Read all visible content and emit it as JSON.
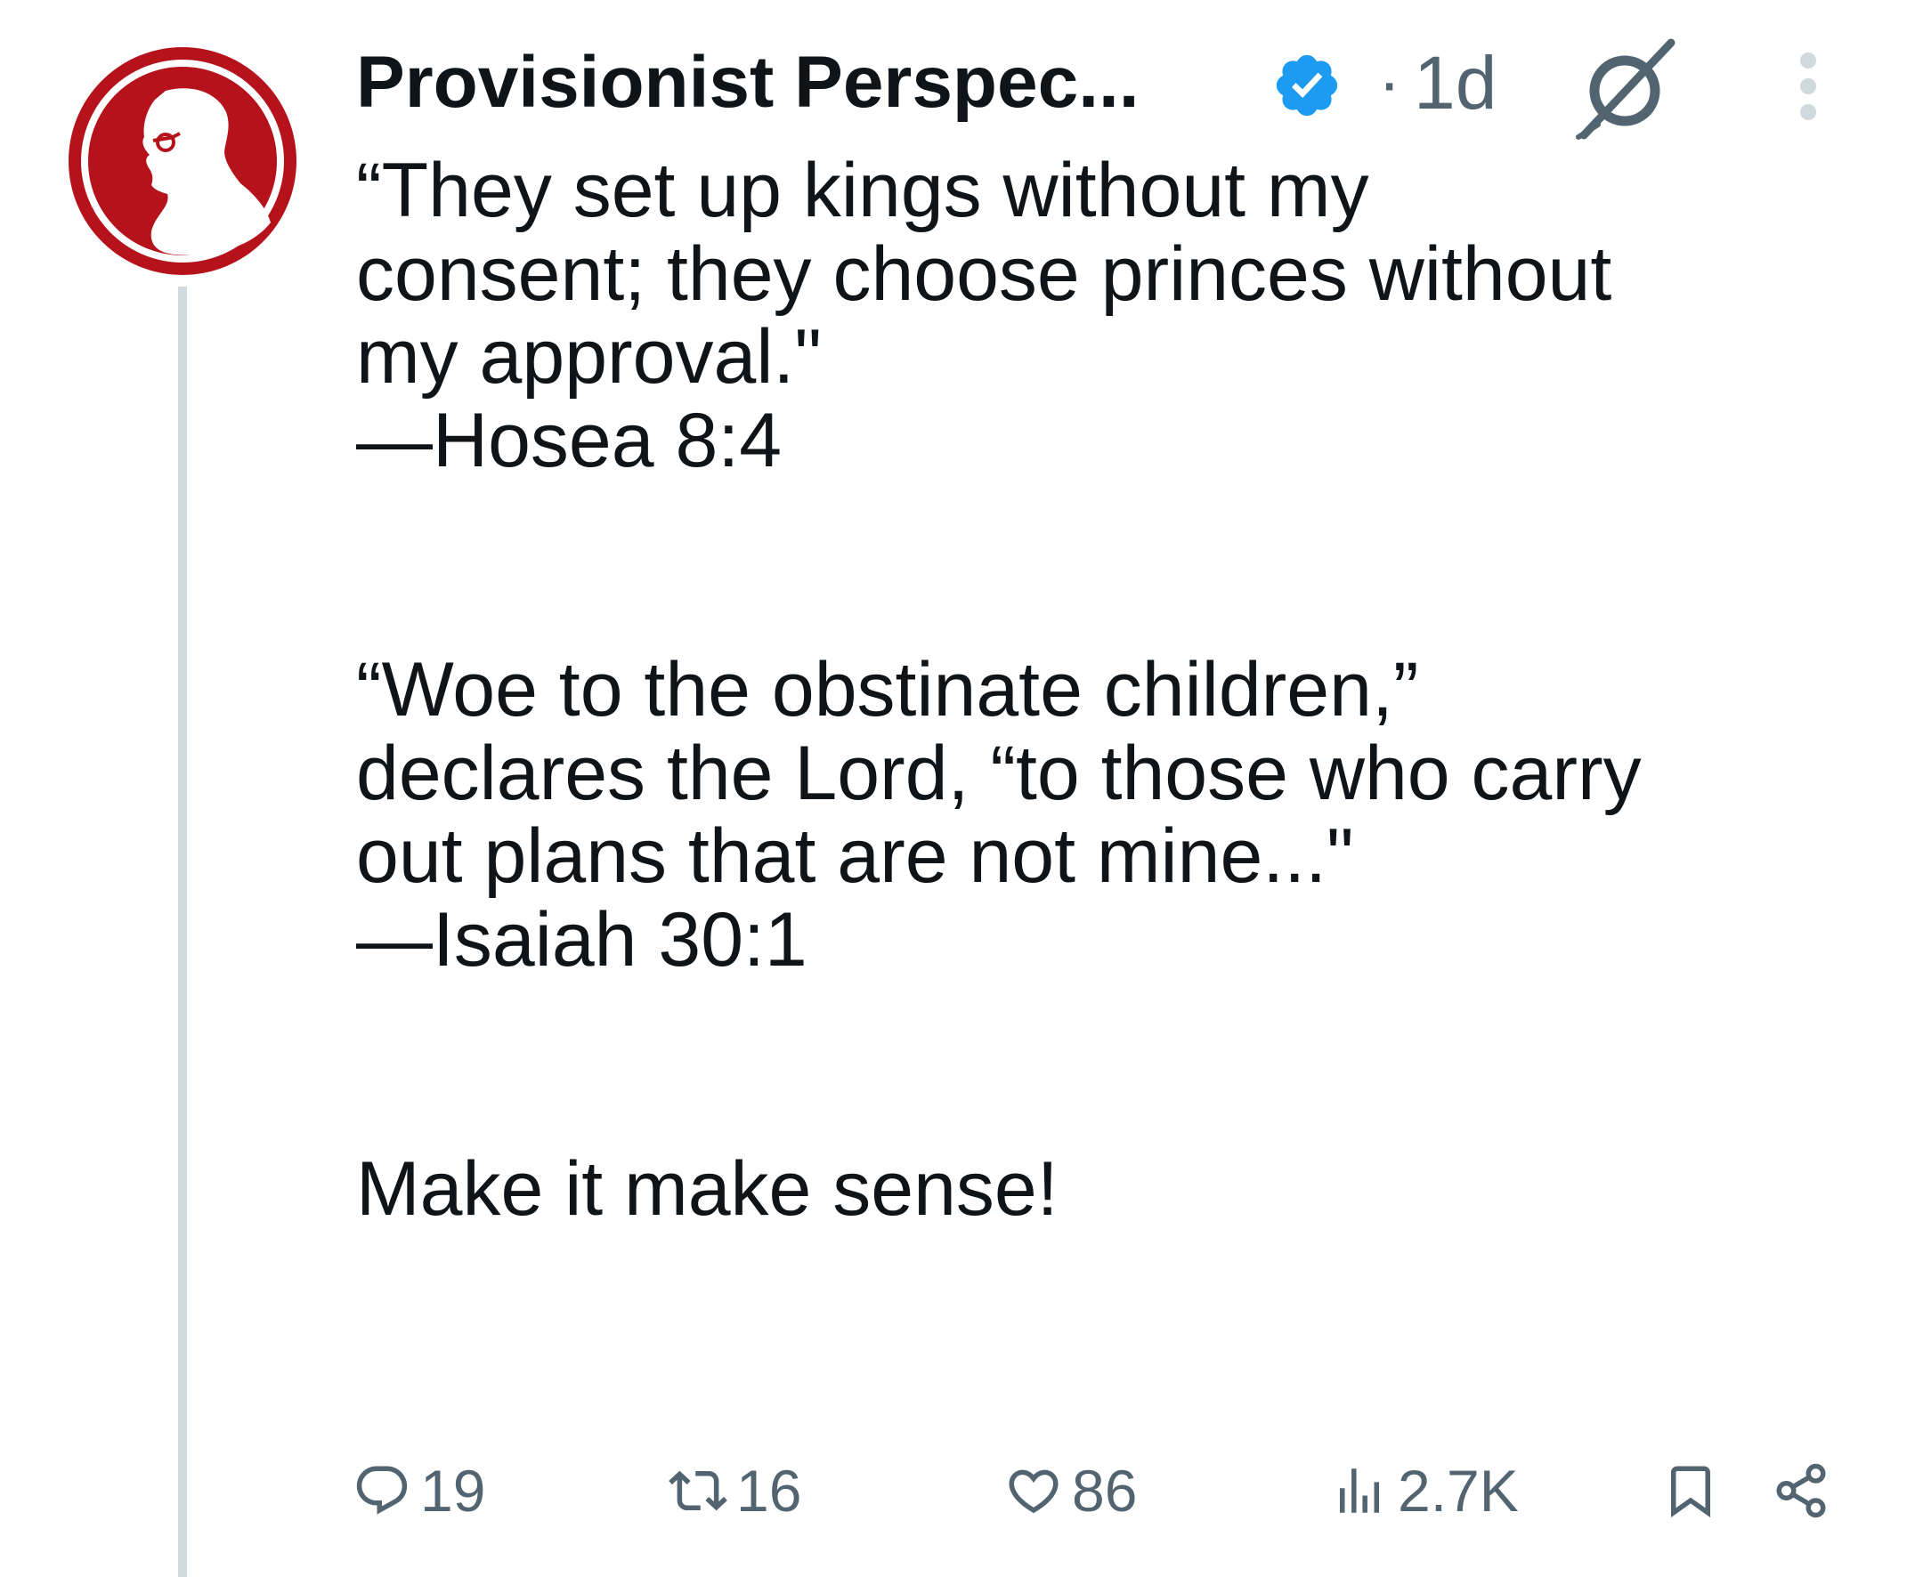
{
  "author": {
    "display_name": "Provisionist Perspec...",
    "timestamp": "1d",
    "separator": "·",
    "avatar_colors": {
      "ring": "#b5121b",
      "inner": "#b5121b",
      "figure": "#ffffff"
    },
    "verified_color": "#1d9bf0"
  },
  "tweet": {
    "paragraph1": "“They set up kings without my\nconsent; they choose princes without\nmy approval.\"\n—Hosea 8:4",
    "paragraph2": "“Woe to the obstinate children,”\ndeclares the Lord, “to those who carry\nout plans that are not mine...\"\n—Isaiah 30:1",
    "paragraph3": "Make it make sense!"
  },
  "actions": {
    "reply_count": "19",
    "retweet_count": "16",
    "like_count": "86",
    "views_count": "2.7K"
  },
  "icons": {
    "header": [
      "verified-badge-icon",
      "grok-icon",
      "more-options-icon"
    ],
    "actions": [
      "reply-icon",
      "retweet-icon",
      "like-icon",
      "views-icon",
      "bookmark-icon",
      "share-icon"
    ]
  },
  "colors": {
    "text": "#0f1419",
    "muted": "#536471",
    "thread_line": "#cfd9de"
  }
}
